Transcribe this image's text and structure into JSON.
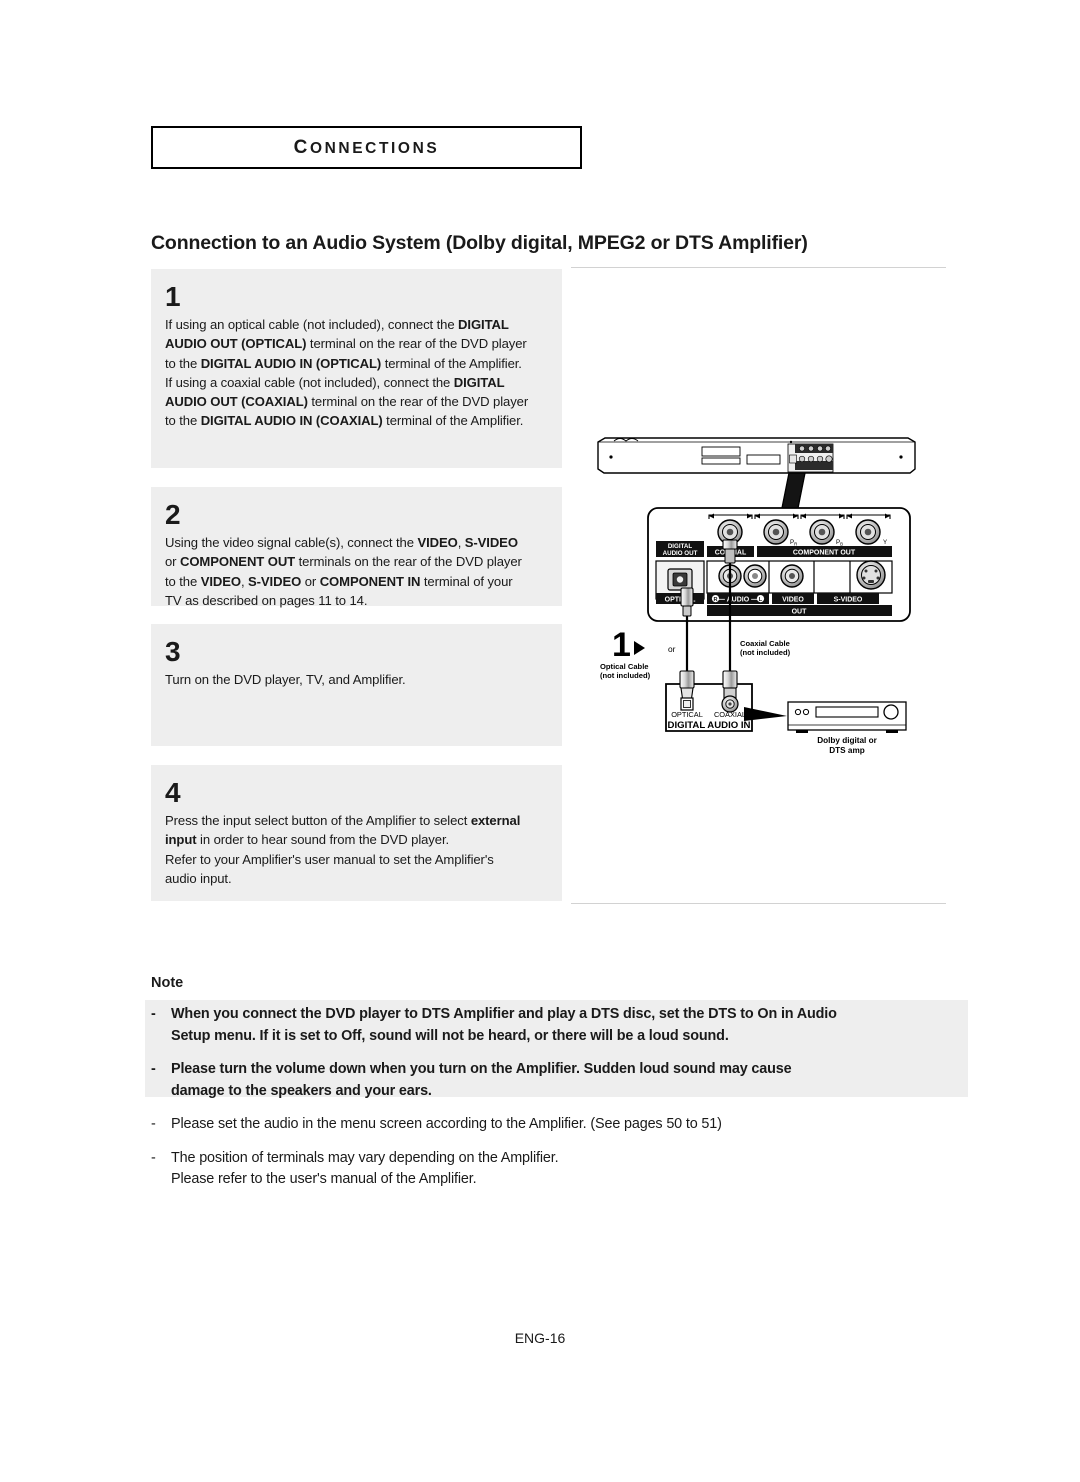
{
  "chapter": {
    "label": "CONNECTIONS"
  },
  "section": {
    "title": "Connection to an Audio System (Dolby digital, MPEG2 or DTS Amplifier)"
  },
  "steps": [
    {
      "number": "1",
      "lines": [
        [
          {
            "t": "If using an optical cable (not included), connect the ",
            "b": false
          },
          {
            "t": "DIGITAL",
            "b": true
          }
        ],
        [
          {
            "t": "AUDIO OUT (OPTICAL)",
            "b": true
          },
          {
            "t": " terminal on the rear of the DVD player",
            "b": false
          }
        ],
        [
          {
            "t": "to the ",
            "b": false
          },
          {
            "t": "DIGITAL AUDIO IN (OPTICAL)",
            "b": true
          },
          {
            "t": " terminal of the Amplifier.",
            "b": false
          }
        ],
        [
          {
            "t": "If using a coaxial cable (not included), connect the ",
            "b": false
          },
          {
            "t": "DIGITAL",
            "b": true
          }
        ],
        [
          {
            "t": "AUDIO OUT (COAXIAL)",
            "b": true
          },
          {
            "t": " terminal on the rear of the DVD player",
            "b": false
          }
        ],
        [
          {
            "t": "to the ",
            "b": false
          },
          {
            "t": "DIGITAL AUDIO IN (COAXIAL)",
            "b": true
          },
          {
            "t": " terminal of the Amplifier.",
            "b": false
          }
        ]
      ]
    },
    {
      "number": "2",
      "lines": [
        [
          {
            "t": "Using the video signal cable(s), connect the ",
            "b": false
          },
          {
            "t": "VIDEO",
            "b": true
          },
          {
            "t": ", ",
            "b": false
          },
          {
            "t": "S-VIDEO",
            "b": true
          }
        ],
        [
          {
            "t": "or ",
            "b": false
          },
          {
            "t": "COMPONENT OUT",
            "b": true
          },
          {
            "t": " terminals on the rear of the DVD player",
            "b": false
          }
        ],
        [
          {
            "t": "to the ",
            "b": false
          },
          {
            "t": "VIDEO",
            "b": true
          },
          {
            "t": ", ",
            "b": false
          },
          {
            "t": "S-VIDEO",
            "b": true
          },
          {
            "t": " or ",
            "b": false
          },
          {
            "t": "COMPONENT IN",
            "b": true
          },
          {
            "t": " terminal of your",
            "b": false
          }
        ],
        [
          {
            "t": "TV as described on pages 11 to 14.",
            "b": false
          }
        ]
      ]
    },
    {
      "number": "3",
      "lines": [
        [
          {
            "t": "Turn on the DVD player, TV, and Amplifier.",
            "b": false
          }
        ]
      ]
    },
    {
      "number": "4",
      "lines": [
        [
          {
            "t": "Press the input select button of the Amplifier to select ",
            "b": false
          },
          {
            "t": "external",
            "b": true
          }
        ],
        [
          {
            "t": "input",
            "b": true
          },
          {
            "t": " in order to hear sound from the DVD player.",
            "b": false
          }
        ],
        [
          {
            "t": "Refer to your Amplifier's user manual to set the Amplifier's",
            "b": false
          }
        ],
        [
          {
            "t": "audio input.",
            "b": false
          }
        ]
      ]
    }
  ],
  "note": {
    "heading": "Note",
    "dash": "-",
    "items": [
      {
        "style": "bold",
        "lines": [
          "When you connect the DVD player to DTS Amplifier and play a DTS disc, set the DTS to On in Audio",
          "Setup menu. If it is set to Off, sound will not be heard, or there will be a loud sound."
        ]
      },
      {
        "style": "bold",
        "lines": [
          "Please turn the volume down when you turn on the Amplifier. Sudden loud sound may cause",
          "damage to the speakers and your ears."
        ]
      },
      {
        "style": "plain",
        "lines": [
          "Please set the audio in the menu screen according to the Amplifier. (See pages 50 to 51)"
        ]
      },
      {
        "style": "plain",
        "lines": [
          "The position of terminals may vary depending on the Amplifier.",
          "Please refer to the user's manual of the Amplifier."
        ]
      }
    ]
  },
  "diagram": {
    "rear_panel_labels": {
      "digital_audio_out": "DIGITAL\nAUDIO OUT",
      "digital_audio_out_line1": "DIGITAL",
      "digital_audio_out_line2": "AUDIO OUT",
      "coaxial": "COAXIAL",
      "optical": "OPTICAL",
      "component_out": "COMPONENT  OUT",
      "component_pr": "P",
      "component_pr_sub": "R",
      "component_pb": "P",
      "component_pb_sub": "B",
      "component_y": "Y",
      "audio": "AUDIO",
      "audio_r": "R",
      "audio_l": "L",
      "video": "VIDEO",
      "s_video": "S-VIDEO",
      "out": "OUT"
    },
    "callouts": {
      "step_marker": "1",
      "optical_cable_line1": "Optical Cable",
      "optical_cable_line2": "(not included)",
      "or": "or",
      "coaxial_cable_line1": "Coaxial Cable",
      "coaxial_cable_line2": "(not included)"
    },
    "amplifier_panel": {
      "optical": "OPTICAL",
      "coaxial": "COAXIAL",
      "digital_audio_in": "DIGITAL AUDIO IN",
      "amp_caption_line1": "Dolby digital or",
      "amp_caption_line2": "DTS amp"
    }
  },
  "footer": {
    "page": "ENG-16"
  },
  "colors": {
    "shade": "#eeeeee",
    "rule": "#d2d2d2",
    "ink": "#1a1a1a"
  }
}
